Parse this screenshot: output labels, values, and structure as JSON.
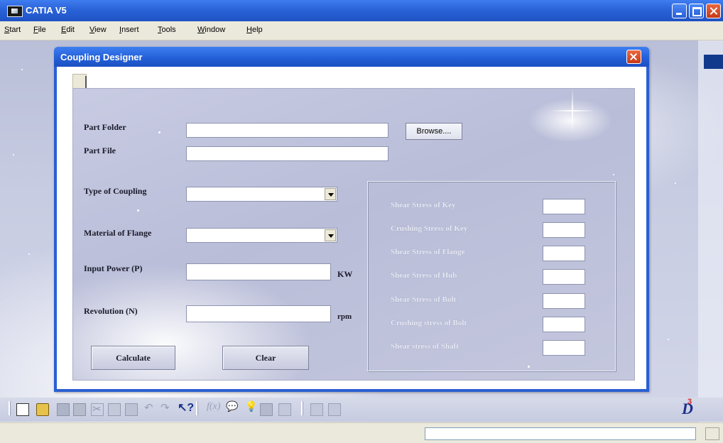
{
  "app": {
    "title": "CATIA V5"
  },
  "menu": [
    "Start",
    "File",
    "Edit",
    "View",
    "Insert",
    "Tools",
    "Window",
    "Help"
  ],
  "dialog": {
    "title": "Coupling Designer",
    "fields": {
      "part_folder": {
        "label": "Part Folder",
        "value": ""
      },
      "part_file": {
        "label": "Part File",
        "value": ""
      },
      "type_of_coupling": {
        "label": "Type of Coupling",
        "value": ""
      },
      "material_of_flange": {
        "label": "Material of Flange",
        "value": ""
      },
      "input_power": {
        "label": "Input Power (P)",
        "value": "",
        "unit": "KW"
      },
      "revolution": {
        "label": "Revolution (N)",
        "value": "",
        "unit": "rpm"
      }
    },
    "buttons": {
      "browse": "Browse....",
      "calculate": "Calculate",
      "clear": "Clear"
    },
    "results": [
      {
        "label": "Shear Stress of Key",
        "value": ""
      },
      {
        "label": "Crushing Stress of Key",
        "value": ""
      },
      {
        "label": "Shear Stress of Flange",
        "value": ""
      },
      {
        "label": "Shear Stress of Hub",
        "value": ""
      },
      {
        "label": "Shear Stress of Bolt",
        "value": ""
      },
      {
        "label": "Crushing stress of Bolt",
        "value": ""
      },
      {
        "label": "Shear stress of Shaft",
        "value": ""
      }
    ]
  },
  "toolbar": {
    "icons": [
      "new-icon",
      "open-icon",
      "save-icon",
      "print-icon",
      "cut-icon",
      "copy-icon",
      "paste-icon",
      "undo-icon",
      "redo-icon",
      "whats-this-help-icon",
      "formula-icon",
      "comment-icon",
      "knowledge-icon",
      "table-icon",
      "measure-icon",
      "tool-icon",
      "tool-icon"
    ]
  },
  "colors": {
    "titlebar": "#2a63d8",
    "panel": "#b9bdd8",
    "accent_close": "#c83a18"
  }
}
